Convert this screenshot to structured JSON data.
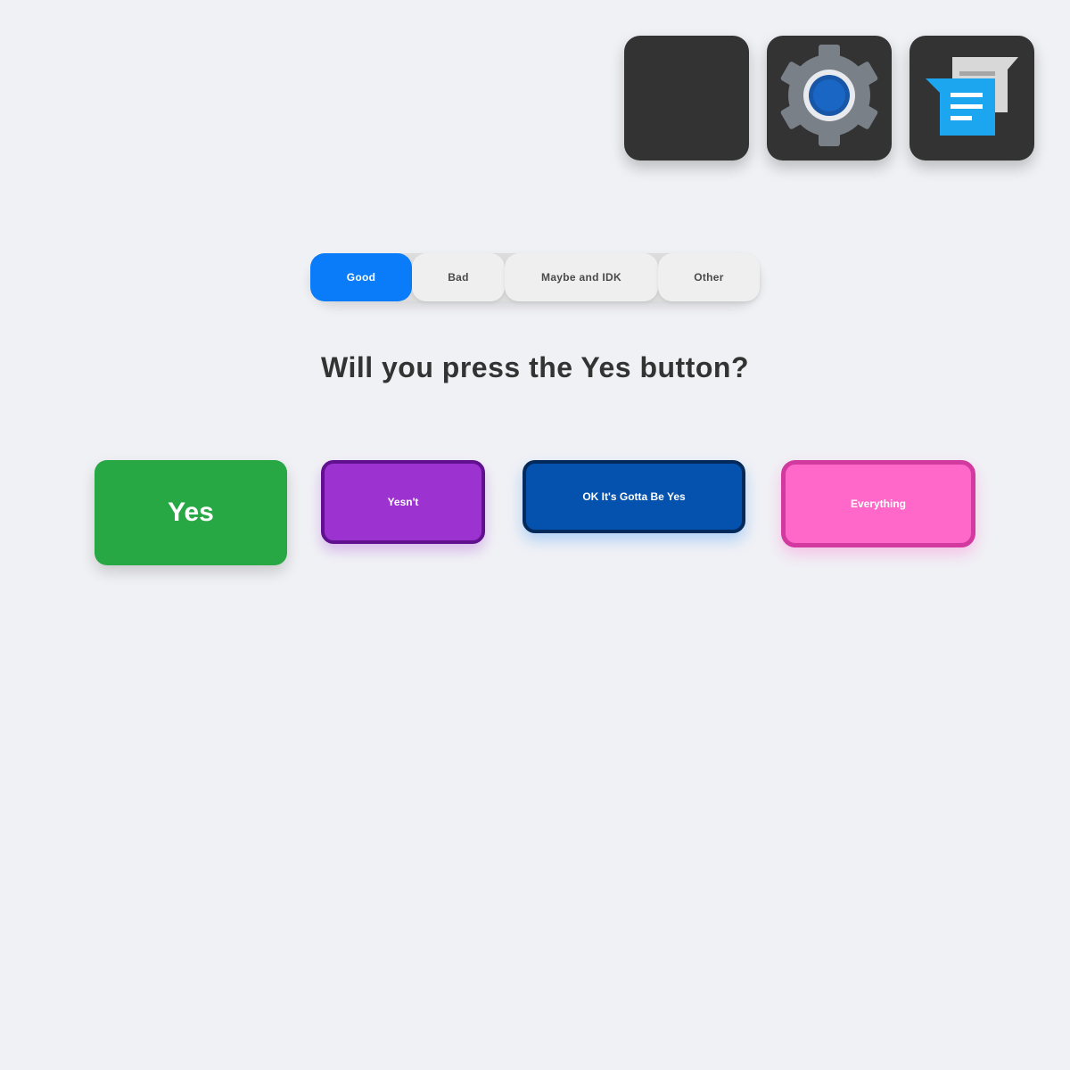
{
  "apps": {
    "blank": {
      "icon": "blank-app-icon"
    },
    "settings": {
      "icon": "gear-icon"
    },
    "messages": {
      "icon": "messages-icon"
    }
  },
  "segmented_control": {
    "options": [
      {
        "label": "Good",
        "selected": true
      },
      {
        "label": "Bad",
        "selected": false
      },
      {
        "label": "Maybe and IDK",
        "selected": false
      },
      {
        "label": "Other",
        "selected": false
      }
    ]
  },
  "question": "Will you press the Yes button?",
  "answers": [
    {
      "label": "Yes",
      "color": "#28a745"
    },
    {
      "label": "Yesn't",
      "color": "#9c33d0"
    },
    {
      "label": "OK It's Gotta Be Yes",
      "color": "#0451ae"
    },
    {
      "label": "Everything",
      "color": "#ff68c9"
    }
  ],
  "colors": {
    "background": "#f0f1f5",
    "accent": "#0a7cf9",
    "tile": "#333333"
  }
}
